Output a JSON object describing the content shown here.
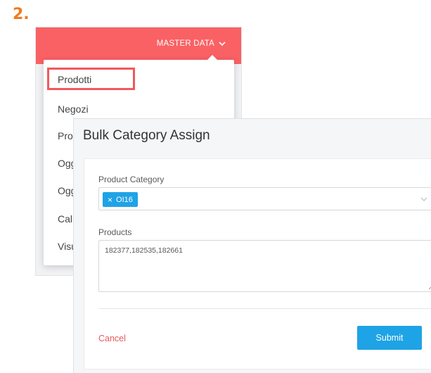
{
  "step": {
    "number": "2."
  },
  "header": {
    "master_data_label": "MASTER DATA",
    "color": "#fa6164"
  },
  "menu": {
    "items": [
      {
        "label": "Prodotti"
      },
      {
        "label": "Negozi"
      },
      {
        "label": "Pro"
      },
      {
        "label": "Ogg"
      },
      {
        "label": "Ogg"
      },
      {
        "label": "Cal"
      },
      {
        "label": "Visu"
      }
    ]
  },
  "modal": {
    "title": "Bulk Category Assign",
    "category_label": "Product Category",
    "selected_tag": "OI16",
    "products_label": "Products",
    "products_value": "182377,182535,182661",
    "cancel_label": "Cancel",
    "submit_label": "Submit"
  },
  "colors": {
    "accent": "#1ea3e6",
    "danger": "#e8585c",
    "highlight": "#f0595c",
    "step": "#f07a1e"
  }
}
